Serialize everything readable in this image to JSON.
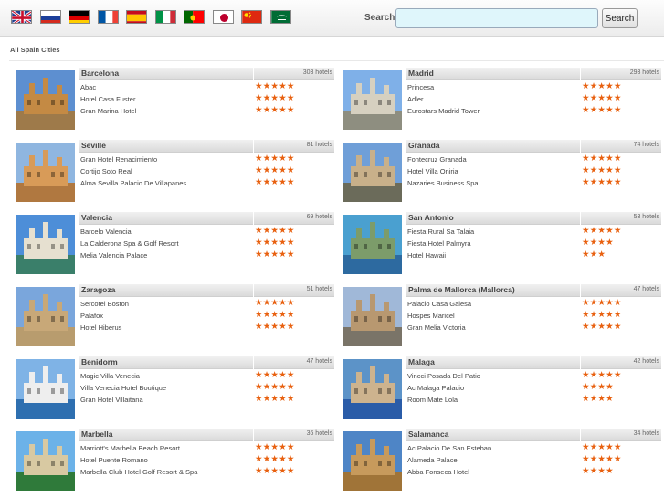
{
  "header": {
    "flags": [
      {
        "icon": "uk-flag-icon",
        "code": "EN"
      },
      {
        "icon": "russia-flag-icon",
        "code": "RU"
      },
      {
        "icon": "germany-flag-icon",
        "code": "DE"
      },
      {
        "icon": "france-flag-icon",
        "code": "FR"
      },
      {
        "icon": "spain-flag-icon",
        "code": "ES"
      },
      {
        "icon": "italy-flag-icon",
        "code": "IT"
      },
      {
        "icon": "portugal-flag-icon",
        "code": "PT"
      },
      {
        "icon": "japan-flag-icon",
        "code": "JA"
      },
      {
        "icon": "china-flag-icon",
        "code": "CN"
      },
      {
        "icon": "saudi-flag-icon",
        "code": "AR"
      }
    ],
    "search_label": "Search",
    "search_value": "",
    "search_button": "Search"
  },
  "breadcrumb": "All Spain Cities",
  "star_color": "#e8600f",
  "cities": [
    {
      "name": "Barcelona",
      "count": "303 hotels",
      "image": "barcelona-photo",
      "hotels": [
        {
          "name": "Abac",
          "stars": 5
        },
        {
          "name": "Hotel Casa Fuster",
          "stars": 5
        },
        {
          "name": "Gran Marina Hotel",
          "stars": 5
        }
      ]
    },
    {
      "name": "Madrid",
      "count": "293 hotels",
      "image": "madrid-photo",
      "hotels": [
        {
          "name": "Princesa",
          "stars": 5
        },
        {
          "name": "Adler",
          "stars": 5
        },
        {
          "name": "Eurostars Madrid Tower",
          "stars": 5
        }
      ]
    },
    {
      "name": "Seville",
      "count": "81 hotels",
      "image": "seville-photo",
      "hotels": [
        {
          "name": "Gran Hotel Renacimiento",
          "stars": 5
        },
        {
          "name": "Cortijo Soto Real",
          "stars": 5
        },
        {
          "name": "Alma Sevilla Palacio De Villapanes",
          "stars": 5
        }
      ]
    },
    {
      "name": "Granada",
      "count": "74 hotels",
      "image": "granada-photo",
      "hotels": [
        {
          "name": "Fontecruz Granada",
          "stars": 5
        },
        {
          "name": "Hotel Villa Oniria",
          "stars": 5
        },
        {
          "name": "Nazaries Business Spa",
          "stars": 5
        }
      ]
    },
    {
      "name": "Valencia",
      "count": "69 hotels",
      "image": "valencia-photo",
      "hotels": [
        {
          "name": "Barcelo Valencia",
          "stars": 5
        },
        {
          "name": "La Calderona Spa & Golf Resort",
          "stars": 5
        },
        {
          "name": "Melia Valencia Palace",
          "stars": 5
        }
      ]
    },
    {
      "name": "San Antonio",
      "count": "53 hotels",
      "image": "san-antonio-photo",
      "hotels": [
        {
          "name": "Fiesta Rural Sa Talaia",
          "stars": 5
        },
        {
          "name": "Fiesta Hotel Palmyra",
          "stars": 4
        },
        {
          "name": "Hotel Hawaii",
          "stars": 3
        }
      ]
    },
    {
      "name": "Zaragoza",
      "count": "51 hotels",
      "image": "zaragoza-photo",
      "hotels": [
        {
          "name": "Sercotel Boston",
          "stars": 5
        },
        {
          "name": "Palafox",
          "stars": 5
        },
        {
          "name": "Hotel Hiberus",
          "stars": 5
        }
      ]
    },
    {
      "name": "Palma de Mallorca (Mallorca)",
      "count": "47 hotels",
      "image": "palma-photo",
      "hotels": [
        {
          "name": "Palacio Casa Galesa",
          "stars": 5
        },
        {
          "name": "Hospes Maricel",
          "stars": 5
        },
        {
          "name": "Gran Melia Victoria",
          "stars": 5
        }
      ]
    },
    {
      "name": "Benidorm",
      "count": "47 hotels",
      "image": "benidorm-photo",
      "hotels": [
        {
          "name": "Magic Villa Venecia",
          "stars": 5
        },
        {
          "name": "Villa Venecia Hotel Boutique",
          "stars": 5
        },
        {
          "name": "Gran Hotel Villaitana",
          "stars": 5
        }
      ]
    },
    {
      "name": "Malaga",
      "count": "42 hotels",
      "image": "malaga-photo",
      "hotels": [
        {
          "name": "Vincci Posada Del Patio",
          "stars": 5
        },
        {
          "name": "Ac Malaga Palacio",
          "stars": 4
        },
        {
          "name": "Room Mate Lola",
          "stars": 4
        }
      ]
    },
    {
      "name": "Marbella",
      "count": "36 hotels",
      "image": "marbella-photo",
      "hotels": [
        {
          "name": "Marriott's Marbella Beach Resort",
          "stars": 5
        },
        {
          "name": "Hotel Puente Romano",
          "stars": 5
        },
        {
          "name": "Marbella Club Hotel Golf Resort & Spa",
          "stars": 5
        }
      ]
    },
    {
      "name": "Salamanca",
      "count": "34 hotels",
      "image": "salamanca-photo",
      "hotels": [
        {
          "name": "Ac Palacio De San Esteban",
          "stars": 5
        },
        {
          "name": "Alameda Palace",
          "stars": 5
        },
        {
          "name": "Abba Fonseca Hotel",
          "stars": 4
        }
      ]
    }
  ]
}
